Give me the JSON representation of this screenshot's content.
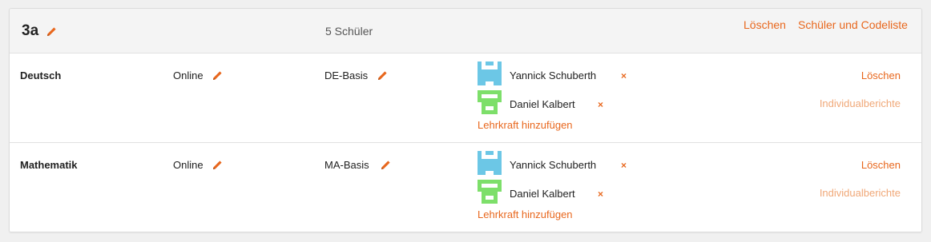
{
  "colors": {
    "accent": "#e8671d",
    "accent_muted": "#f0a878",
    "avatar_blue": "#6cc7e6",
    "avatar_green": "#7ddf6a"
  },
  "class_group": {
    "name": "3a",
    "edit_icon": "pencil-icon",
    "student_count": "5 Schüler",
    "delete_label": "Löschen",
    "codelist_label": "Schüler und Codeliste"
  },
  "subjects": [
    {
      "name": "Deutsch",
      "mode": "Online",
      "course": "DE-Basis",
      "teachers": [
        {
          "name": "Yannick Schuberth",
          "avatar": "pixel-avatar-blue",
          "remove_icon": "×"
        },
        {
          "name": "Daniel Kalbert",
          "avatar": "pixel-avatar-green",
          "remove_icon": "×"
        }
      ],
      "add_teacher_label": "Lehrkraft hinzufügen",
      "delete_label": "Löschen",
      "reports_label": "Individualberichte"
    },
    {
      "name": "Mathematik",
      "mode": "Online",
      "course": "MA-Basis",
      "teachers": [
        {
          "name": "Yannick Schuberth",
          "avatar": "pixel-avatar-blue",
          "remove_icon": "×"
        },
        {
          "name": "Daniel Kalbert",
          "avatar": "pixel-avatar-green",
          "remove_icon": "×"
        }
      ],
      "add_teacher_label": "Lehrkraft hinzufügen",
      "delete_label": "Löschen",
      "reports_label": "Individualberichte"
    }
  ]
}
